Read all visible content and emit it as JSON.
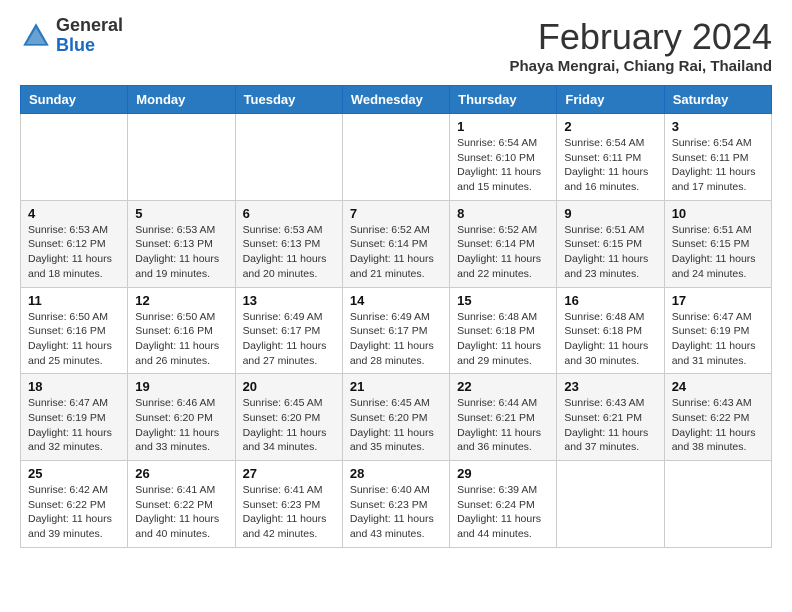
{
  "logo": {
    "general": "General",
    "blue": "Blue"
  },
  "title": "February 2024",
  "location": "Phaya Mengrai, Chiang Rai, Thailand",
  "weekdays": [
    "Sunday",
    "Monday",
    "Tuesday",
    "Wednesday",
    "Thursday",
    "Friday",
    "Saturday"
  ],
  "weeks": [
    [
      {
        "day": "",
        "info": ""
      },
      {
        "day": "",
        "info": ""
      },
      {
        "day": "",
        "info": ""
      },
      {
        "day": "",
        "info": ""
      },
      {
        "day": "1",
        "info": "Sunrise: 6:54 AM\nSunset: 6:10 PM\nDaylight: 11 hours and 15 minutes."
      },
      {
        "day": "2",
        "info": "Sunrise: 6:54 AM\nSunset: 6:11 PM\nDaylight: 11 hours and 16 minutes."
      },
      {
        "day": "3",
        "info": "Sunrise: 6:54 AM\nSunset: 6:11 PM\nDaylight: 11 hours and 17 minutes."
      }
    ],
    [
      {
        "day": "4",
        "info": "Sunrise: 6:53 AM\nSunset: 6:12 PM\nDaylight: 11 hours and 18 minutes."
      },
      {
        "day": "5",
        "info": "Sunrise: 6:53 AM\nSunset: 6:13 PM\nDaylight: 11 hours and 19 minutes."
      },
      {
        "day": "6",
        "info": "Sunrise: 6:53 AM\nSunset: 6:13 PM\nDaylight: 11 hours and 20 minutes."
      },
      {
        "day": "7",
        "info": "Sunrise: 6:52 AM\nSunset: 6:14 PM\nDaylight: 11 hours and 21 minutes."
      },
      {
        "day": "8",
        "info": "Sunrise: 6:52 AM\nSunset: 6:14 PM\nDaylight: 11 hours and 22 minutes."
      },
      {
        "day": "9",
        "info": "Sunrise: 6:51 AM\nSunset: 6:15 PM\nDaylight: 11 hours and 23 minutes."
      },
      {
        "day": "10",
        "info": "Sunrise: 6:51 AM\nSunset: 6:15 PM\nDaylight: 11 hours and 24 minutes."
      }
    ],
    [
      {
        "day": "11",
        "info": "Sunrise: 6:50 AM\nSunset: 6:16 PM\nDaylight: 11 hours and 25 minutes."
      },
      {
        "day": "12",
        "info": "Sunrise: 6:50 AM\nSunset: 6:16 PM\nDaylight: 11 hours and 26 minutes."
      },
      {
        "day": "13",
        "info": "Sunrise: 6:49 AM\nSunset: 6:17 PM\nDaylight: 11 hours and 27 minutes."
      },
      {
        "day": "14",
        "info": "Sunrise: 6:49 AM\nSunset: 6:17 PM\nDaylight: 11 hours and 28 minutes."
      },
      {
        "day": "15",
        "info": "Sunrise: 6:48 AM\nSunset: 6:18 PM\nDaylight: 11 hours and 29 minutes."
      },
      {
        "day": "16",
        "info": "Sunrise: 6:48 AM\nSunset: 6:18 PM\nDaylight: 11 hours and 30 minutes."
      },
      {
        "day": "17",
        "info": "Sunrise: 6:47 AM\nSunset: 6:19 PM\nDaylight: 11 hours and 31 minutes."
      }
    ],
    [
      {
        "day": "18",
        "info": "Sunrise: 6:47 AM\nSunset: 6:19 PM\nDaylight: 11 hours and 32 minutes."
      },
      {
        "day": "19",
        "info": "Sunrise: 6:46 AM\nSunset: 6:20 PM\nDaylight: 11 hours and 33 minutes."
      },
      {
        "day": "20",
        "info": "Sunrise: 6:45 AM\nSunset: 6:20 PM\nDaylight: 11 hours and 34 minutes."
      },
      {
        "day": "21",
        "info": "Sunrise: 6:45 AM\nSunset: 6:20 PM\nDaylight: 11 hours and 35 minutes."
      },
      {
        "day": "22",
        "info": "Sunrise: 6:44 AM\nSunset: 6:21 PM\nDaylight: 11 hours and 36 minutes."
      },
      {
        "day": "23",
        "info": "Sunrise: 6:43 AM\nSunset: 6:21 PM\nDaylight: 11 hours and 37 minutes."
      },
      {
        "day": "24",
        "info": "Sunrise: 6:43 AM\nSunset: 6:22 PM\nDaylight: 11 hours and 38 minutes."
      }
    ],
    [
      {
        "day": "25",
        "info": "Sunrise: 6:42 AM\nSunset: 6:22 PM\nDaylight: 11 hours and 39 minutes."
      },
      {
        "day": "26",
        "info": "Sunrise: 6:41 AM\nSunset: 6:22 PM\nDaylight: 11 hours and 40 minutes."
      },
      {
        "day": "27",
        "info": "Sunrise: 6:41 AM\nSunset: 6:23 PM\nDaylight: 11 hours and 42 minutes."
      },
      {
        "day": "28",
        "info": "Sunrise: 6:40 AM\nSunset: 6:23 PM\nDaylight: 11 hours and 43 minutes."
      },
      {
        "day": "29",
        "info": "Sunrise: 6:39 AM\nSunset: 6:24 PM\nDaylight: 11 hours and 44 minutes."
      },
      {
        "day": "",
        "info": ""
      },
      {
        "day": "",
        "info": ""
      }
    ]
  ]
}
